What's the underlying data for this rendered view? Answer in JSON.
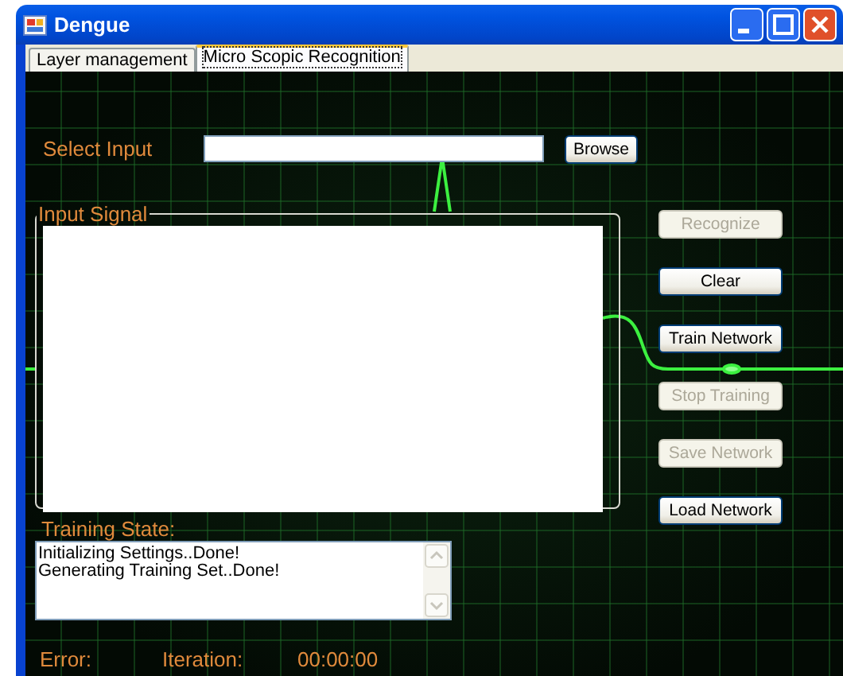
{
  "window": {
    "title": "Dengue"
  },
  "tabs": [
    {
      "label": "Layer management",
      "selected": false
    },
    {
      "label": "Micro Scopic Recognition",
      "selected": true
    }
  ],
  "select_input": {
    "label": "Select Input"
  },
  "browse_button": {
    "label": "Browse",
    "disabled": false
  },
  "input_signal": {
    "title": "Input Signal"
  },
  "buttons": [
    {
      "label": "Recognize",
      "disabled": true
    },
    {
      "label": "Clear",
      "disabled": false
    },
    {
      "label": "Train Network",
      "disabled": false
    },
    {
      "label": "Stop Training",
      "disabled": true
    },
    {
      "label": "Save Network",
      "disabled": true
    },
    {
      "label": "Load Network",
      "disabled": false
    }
  ],
  "training_state": {
    "label": "Training State:",
    "lines": [
      "Initializing Settings..Done!",
      "Generating Training Set..Done!"
    ]
  },
  "status": {
    "error_label": "Error:",
    "iteration_label": "Iteration:",
    "time": "00:00:00"
  }
}
